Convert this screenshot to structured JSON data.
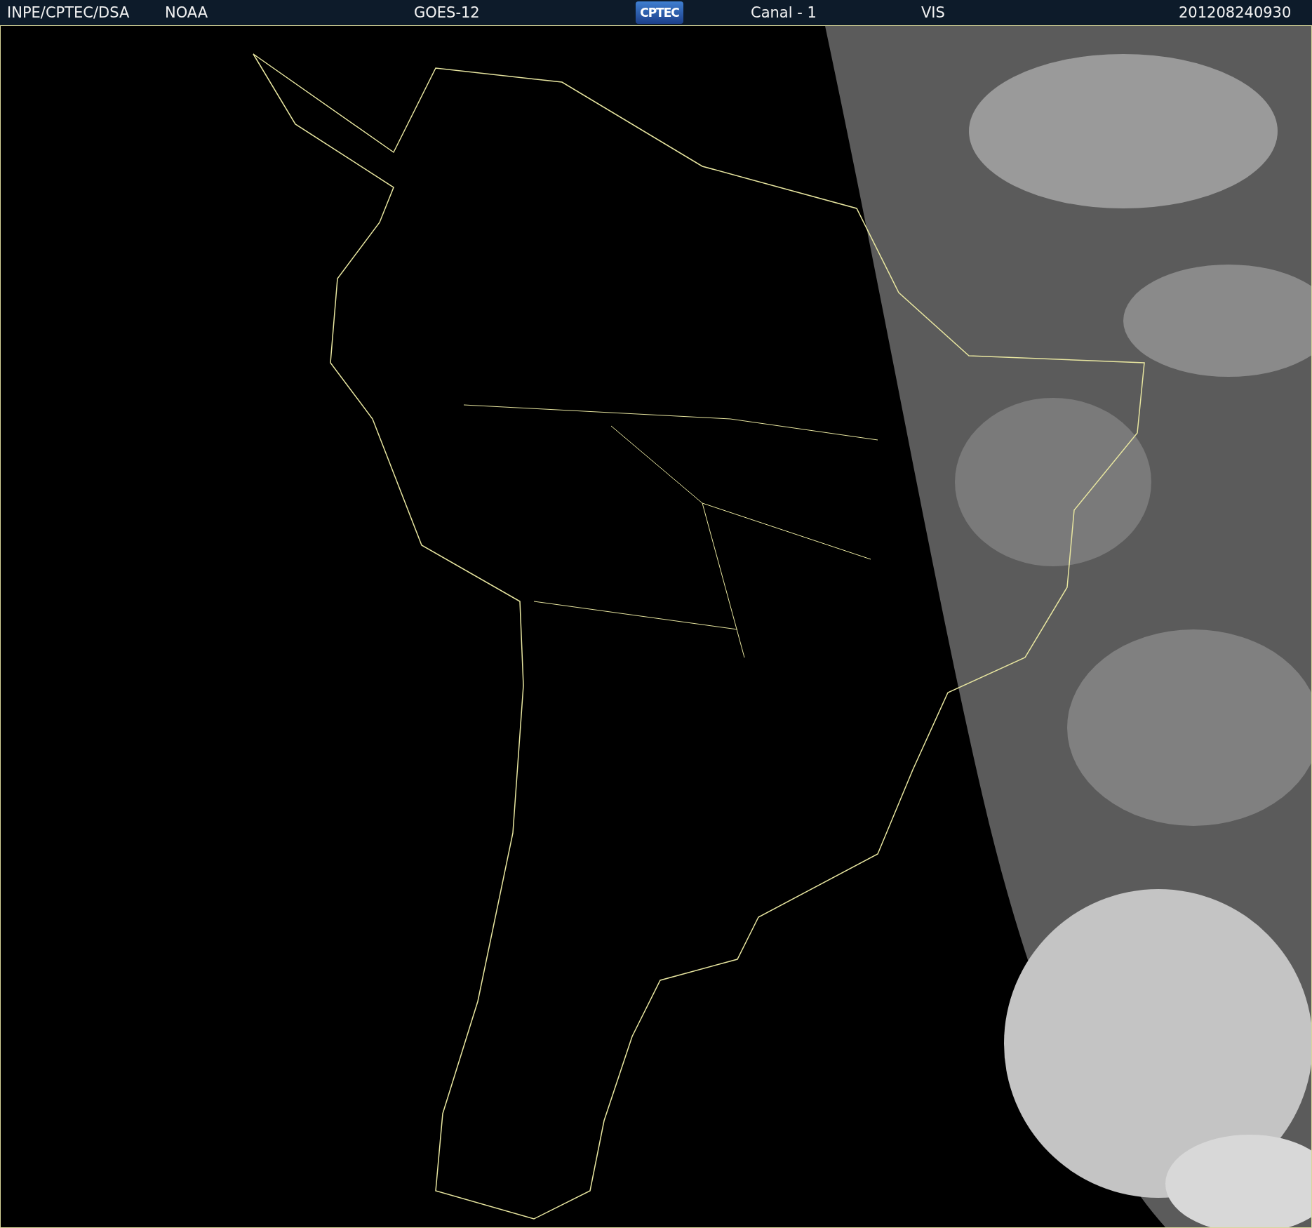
{
  "header": {
    "items": [
      {
        "kind": "text",
        "text": "INPE/CPTEC/DSA"
      },
      {
        "kind": "text",
        "text": "NOAA"
      },
      {
        "kind": "text",
        "text": "GOES-12"
      },
      {
        "kind": "logo",
        "text": "CPTEC"
      },
      {
        "kind": "text",
        "text": "Canal - 1"
      },
      {
        "kind": "text",
        "text": "VIS"
      },
      {
        "kind": "text",
        "text": "201208240930"
      }
    ]
  }
}
